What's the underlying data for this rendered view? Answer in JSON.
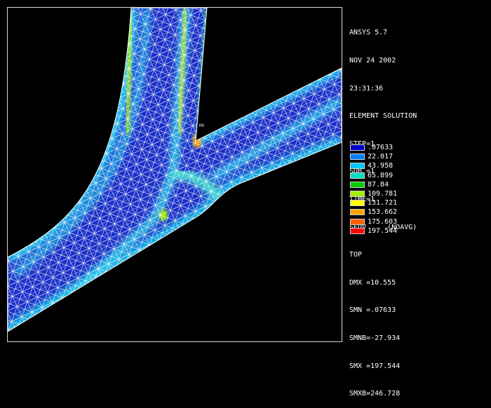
{
  "header": {
    "program": "ANSYS 5.7",
    "date": "NOV 24 2002",
    "time": "23:31:36",
    "plot_type": "ELEMENT SOLUTION"
  },
  "solution": {
    "step": "STEP=1",
    "sub": "SUB =1",
    "time": "TIME=1",
    "result": "SEQV     (NOAVG)",
    "layer": "TOP",
    "dmx": "DMX =10.555",
    "smn": "SMN =.07633",
    "smnb": "SMNB=-27.934",
    "smx": "SMX =197.544",
    "smxb": "SMXB=246.728"
  },
  "plot": {
    "max_marker_label": "MX"
  },
  "legend": {
    "entries": [
      {
        "label": ".07633",
        "color": "#0000c8"
      },
      {
        "label": "22.017",
        "color": "#0080ff"
      },
      {
        "label": "43.958",
        "color": "#00c8ff"
      },
      {
        "label": "65.899",
        "color": "#00e0c0"
      },
      {
        "label": "87.84",
        "color": "#00d000"
      },
      {
        "label": "109.781",
        "color": "#a0f000"
      },
      {
        "label": "131.721",
        "color": "#ffff00"
      },
      {
        "label": "153.662",
        "color": "#ffa500"
      },
      {
        "label": "175.603",
        "color": "#ff6000"
      },
      {
        "label": "197.544",
        "color": "#ff0000"
      }
    ]
  }
}
